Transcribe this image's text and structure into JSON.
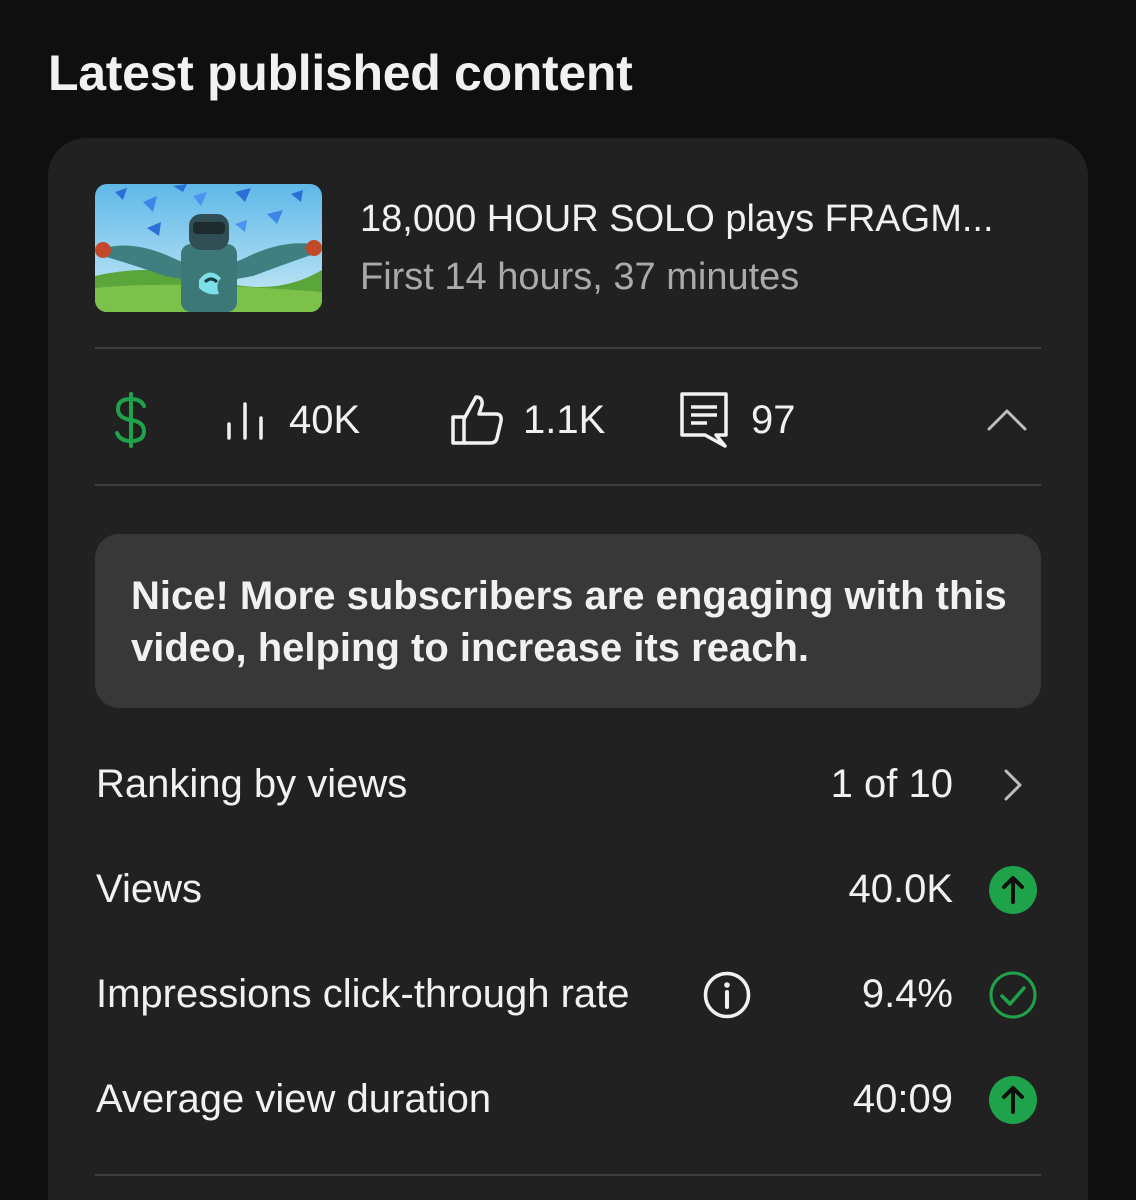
{
  "section": {
    "title": "Latest published content"
  },
  "video": {
    "title": "18,000 HOUR SOLO plays FRAGM...",
    "subtitle": "First 14 hours, 37 minutes",
    "thumbnail_icon": "video-thumbnail"
  },
  "stats": {
    "monetization_icon": "dollar-icon",
    "views_icon": "bar-chart-icon",
    "views": "40K",
    "likes_icon": "thumbs-up-icon",
    "likes": "1.1K",
    "comments_icon": "comment-icon",
    "comments": "97",
    "collapse_icon": "chevron-up-icon"
  },
  "callout": {
    "text": "Nice! More subscribers are engaging with this video, helping to increase its reach."
  },
  "metrics": [
    {
      "label": "Ranking by views",
      "value": "1 of 10",
      "status_icon": "chevron-right-icon"
    },
    {
      "label": "Views",
      "value": "40.0K",
      "status_icon": "arrow-up-circle-icon"
    },
    {
      "label": "Impressions click-through rate",
      "value": "9.4%",
      "status_icon": "check-circle-icon",
      "info_icon": "info-icon"
    },
    {
      "label": "Average view duration",
      "value": "40:09",
      "status_icon": "arrow-up-circle-icon"
    }
  ],
  "colors": {
    "background": "#0f0f0f",
    "card": "#212121",
    "callout": "#383838",
    "accent_green": "#1fa34a",
    "text_primary": "#f1f1f1",
    "text_secondary": "#aaaaaa"
  }
}
